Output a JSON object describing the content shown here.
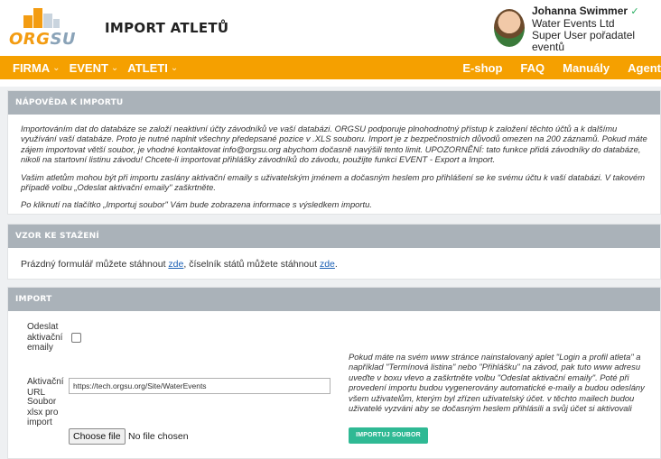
{
  "header": {
    "logo_text_1": "ORG",
    "logo_text_2": "SU",
    "page_title": "IMPORT ATLETŮ",
    "user": {
      "name": "Johanna Swimmer",
      "org": "Water Events Ltd",
      "role": "Super User pořadatel eventů"
    }
  },
  "nav": {
    "left": [
      {
        "label": "FIRMA",
        "has_dropdown": true
      },
      {
        "label": "EVENT",
        "has_dropdown": true
      },
      {
        "label": "ATLETI",
        "has_dropdown": true
      }
    ],
    "right": [
      "E-shop",
      "FAQ",
      "Manuály",
      "Agent"
    ]
  },
  "sections": {
    "help_title": "NÁPOVĚDA K IMPORTU",
    "help_p1": "Importováním dat do databáze se založí neaktivní účty závodníků ve vaší databázi. ORGSU podporuje plnohodnotný přístup k založení těchto účtů a k dalšímu využívání vaší databáze. Proto je nutné naplnit všechny předepsané pozice v .XLS souboru. Import je z bezpečnostních důvodů omezen na 200 záznamů. Pokud máte zájem importovat větší soubor, je vhodné kontaktovat info@orgsu.org abychom dočasně navýšili tento limit. UPOZORNĚNÍ: tato funkce přidá závodníky do databáze, nikoli na startovní listinu závodu! Chcete-li importovat přihlášky závodníků do závodu, použijte funkci EVENT - Export a Import.",
    "help_p2": "Vašim atletům mohou být při importu zaslány aktivační emaily s uživatelským jménem a dočasným heslem pro přihlášení se ke svému účtu k vaší databázi. V takovém případě volbu „Odeslat aktivační emaily\" zaškrtněte.",
    "help_p3": "Po kliknutí na tlačítko „Importuj soubor\" Vám bude zobrazena informace s výsledkem importu.",
    "download_title": "VZOR KE STAŽENÍ",
    "download_text_1": "Prázdný formulář můžete stáhnout",
    "download_link_1": "zde",
    "download_text_2": ", číselník států můžete stáhnout",
    "download_link_2": "zde",
    "download_text_3": ".",
    "import_title": "IMPORT"
  },
  "form": {
    "send_emails_label": "Odeslat aktivační emaily",
    "send_emails_checked": false,
    "url_label": "Aktivační URL",
    "url_value": "https://tech.orgsu.org/Site/WaterEvents",
    "file_label": "Soubor xlsx pro import",
    "choose_file_label": "Choose file",
    "no_file_text": "No file chosen",
    "side_note": "Pokud máte na svém www stránce nainstalovaný aplet \"Login a profil atleta\" a například \"Termínová listina\" nebo \"Přihlášku\" na závod, pak tuto www adresu uveďte v boxu vlevo a zaškrtněte volbu \"Odeslat aktivační emaily\". Poté při provedení importu budou vygenerovány automatické e-maily a budou odeslány všem uživatelům, kterým byl zřízen uživatelský účet. v těchto mailech budou uživatelé vyzváni aby se dočasným heslem přihlásili a svůj účet si aktivovali",
    "import_button": "IMPORTUJ SOUBOR"
  },
  "colors": {
    "brand_orange": "#f5a000",
    "section_header": "#aab2b9",
    "import_button": "#2fb994",
    "link": "#1a5fb4"
  }
}
